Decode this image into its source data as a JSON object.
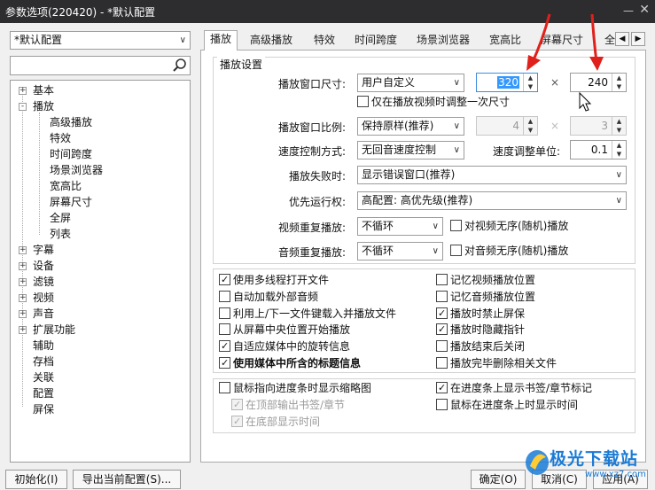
{
  "window": {
    "title": "参数选项(220420) - *默认配置"
  },
  "sidebar": {
    "profile_select": "*默认配置",
    "search_placeholder": "",
    "tree": [
      {
        "label": "基本",
        "level": 0,
        "expander": "+"
      },
      {
        "label": "播放",
        "level": 0,
        "expander": "-"
      },
      {
        "label": "高级播放",
        "level": 1
      },
      {
        "label": "特效",
        "level": 1
      },
      {
        "label": "时间跨度",
        "level": 1
      },
      {
        "label": "场景浏览器",
        "level": 1
      },
      {
        "label": "宽高比",
        "level": 1
      },
      {
        "label": "屏幕尺寸",
        "level": 1
      },
      {
        "label": "全屏",
        "level": 1
      },
      {
        "label": "列表",
        "level": 1
      },
      {
        "label": "字幕",
        "level": 0,
        "expander": "+"
      },
      {
        "label": "设备",
        "level": 0,
        "expander": "+"
      },
      {
        "label": "滤镜",
        "level": 0,
        "expander": "+"
      },
      {
        "label": "视频",
        "level": 0,
        "expander": "+"
      },
      {
        "label": "声音",
        "level": 0,
        "expander": "+"
      },
      {
        "label": "扩展功能",
        "level": 0,
        "expander": "+"
      },
      {
        "label": "辅助",
        "level": 0
      },
      {
        "label": "存档",
        "level": 0
      },
      {
        "label": "关联",
        "level": 0
      },
      {
        "label": "配置",
        "level": 0
      },
      {
        "label": "屏保",
        "level": 0
      }
    ]
  },
  "tabs": [
    "播放",
    "高级播放",
    "特效",
    "时间跨度",
    "场景浏览器",
    "宽高比",
    "屏幕尺寸",
    "全"
  ],
  "group": {
    "title": "播放设置",
    "window_size": {
      "label": "播放窗口尺寸:",
      "value": "用户自定义",
      "width": "320",
      "height": "240",
      "times": "×"
    },
    "only_adjust_once": "仅在播放视频时调整一次尺寸",
    "window_ratio": {
      "label": "播放窗口比例:",
      "value": "保持原样(推荐)",
      "w": "4",
      "h": "3",
      "times": "×"
    },
    "speed_control": {
      "label": "速度控制方式:",
      "value": "无回音速度控制"
    },
    "speed_unit": {
      "label": "速度调整单位:",
      "value": "0.1"
    },
    "play_fail": {
      "label": "播放失败时:",
      "value": "显示错误窗口(推荐)"
    },
    "priority": {
      "label": "优先运行权:",
      "value": "高配置: 高优先级(推荐)"
    },
    "video_repeat": {
      "label": "视频重复播放:",
      "value": "不循环",
      "shuffle": "对视频无序(随机)播放"
    },
    "audio_repeat": {
      "label": "音频重复播放:",
      "value": "不循环",
      "shuffle": "对音频无序(随机)播放"
    }
  },
  "options_left": [
    {
      "label": "使用多线程打开文件",
      "checked": true
    },
    {
      "label": "自动加载外部音频",
      "checked": false
    },
    {
      "label": "利用上/下一文件键载入并播放文件",
      "checked": false
    },
    {
      "label": "从屏幕中央位置开始播放",
      "checked": false
    },
    {
      "label": "自适应媒体中的旋转信息",
      "checked": true
    },
    {
      "label": "使用媒体中所含的标题信息",
      "checked": true
    }
  ],
  "options_right": [
    {
      "label": "记忆视频播放位置",
      "checked": false
    },
    {
      "label": "记忆音频播放位置",
      "checked": false
    },
    {
      "label": "播放时禁止屏保",
      "checked": true
    },
    {
      "label": "播放时隐藏指针",
      "checked": true
    },
    {
      "label": "播放结束后关闭",
      "checked": false
    },
    {
      "label": "播放完毕删除相关文件",
      "checked": false
    }
  ],
  "seekbar": {
    "thumbnail": "鼠标指向进度条时显示缩略图",
    "bookmark_top": "在顶部输出书签/章节",
    "time_bottom": "在底部显示时间",
    "show_bookmarks": "在进度条上显示书签/章节标记",
    "show_time": "鼠标在进度条上时显示时间"
  },
  "buttons": {
    "init": "初始化(I)",
    "export": "导出当前配置(S)...",
    "ok": "确定(O)",
    "cancel": "取消(C)",
    "apply": "应用(A)"
  },
  "watermark": {
    "text": "极光下载站",
    "url": "www.xz7.com"
  },
  "colors": {
    "accent_blue": "#3399ff",
    "annotation_red": "#e0201b"
  }
}
